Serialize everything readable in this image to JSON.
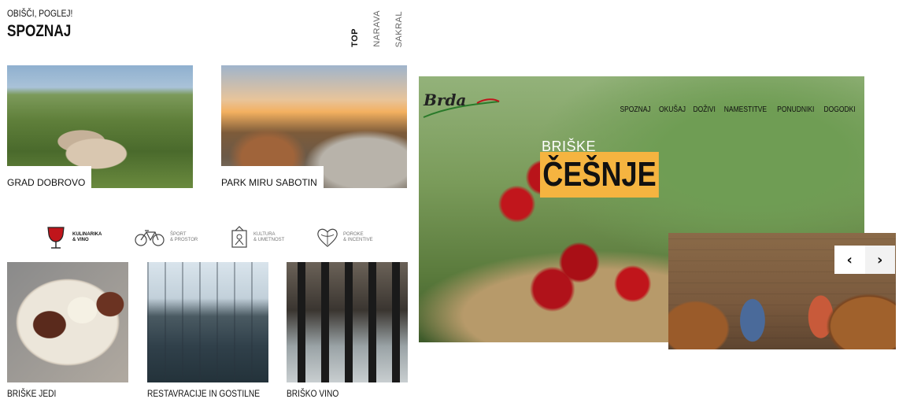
{
  "left": {
    "kicker": "OBIŠČI, POGLEJ!",
    "title": "SPOZNAJ",
    "tabs": [
      "TOP",
      "NARAVA",
      "SAKRAL"
    ],
    "top_cards": [
      {
        "label": "GRAD DOBROVO"
      },
      {
        "label": "PARK MIRU SABOTIN"
      }
    ],
    "categories": [
      {
        "line1": "KULINARIKA",
        "line2": "& VINO",
        "icon": "wine-glass-icon"
      },
      {
        "line1": "ŠPORT",
        "line2": "& PROSTOR",
        "icon": "bicycle-icon"
      },
      {
        "line1": "KULTURA",
        "line2": "& UMETNOST",
        "icon": "culture-icon"
      },
      {
        "line1": "POROKE",
        "line2": "& INCENTIVE",
        "icon": "heart-icon"
      }
    ],
    "bottom_cards": [
      {
        "label": "BRIŠKE JEDI"
      },
      {
        "label": "RESTAVRACIJE IN GOSTILNE"
      },
      {
        "label": "BRIŠKO VINO"
      }
    ]
  },
  "hero": {
    "logo": "Brda",
    "nav": [
      "SPOZNAJ",
      "OKUŠAJ",
      "DOŽIVI",
      "NAMESTITVE",
      "PONUDNIKI",
      "DOGODKI"
    ],
    "subtitle": "BRIŠKE",
    "headline": "ČEŠNJE",
    "accent": "#f5b440"
  },
  "slider": {
    "prev": "‹",
    "next": "›"
  }
}
